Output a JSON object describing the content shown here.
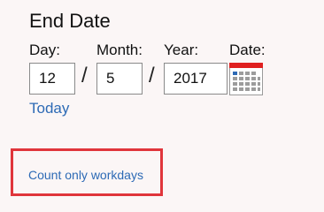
{
  "section": {
    "title": "End Date"
  },
  "fields": {
    "day_label": "Day:",
    "day_value": "12",
    "month_label": "Month:",
    "month_value": "5",
    "year_label": "Year:",
    "year_value": "2017",
    "date_label": "Date:",
    "separator_1": "/",
    "separator_2": "/",
    "calendar_icon": "calendar-icon"
  },
  "actions": {
    "today_label": "Today",
    "workdays_label": "Count only workdays"
  },
  "colors": {
    "link": "#2d6ab5",
    "highlight": "#e0353b",
    "calendar_header": "#e02020"
  }
}
